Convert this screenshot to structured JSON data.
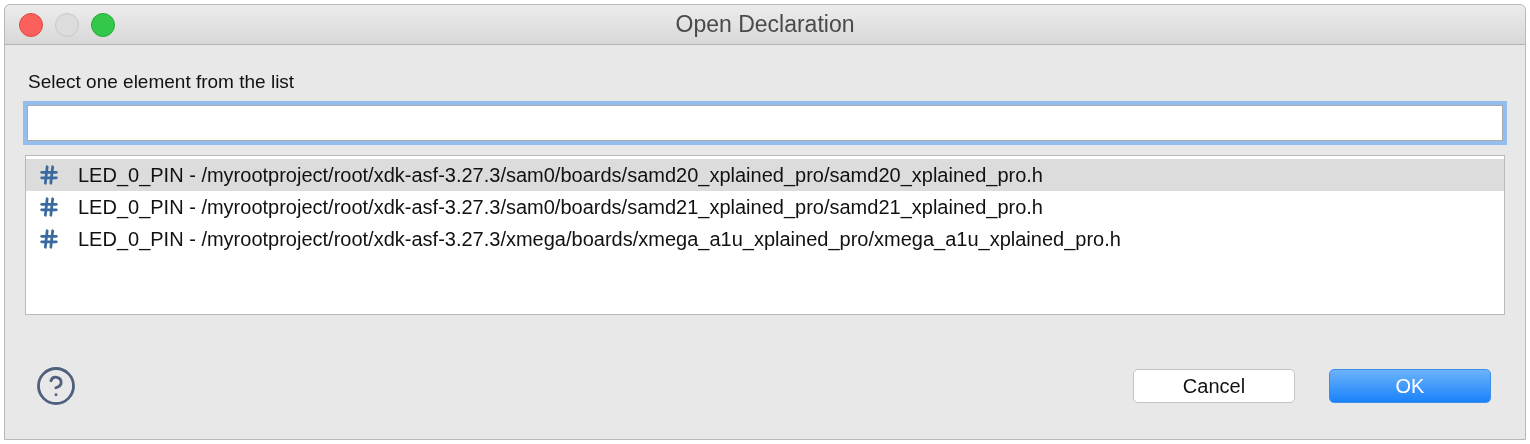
{
  "window": {
    "title": "Open Declaration"
  },
  "prompt": "Select one element from the list",
  "filter": {
    "focused": true
  },
  "items": [
    {
      "label": "LED_0_PIN - /myrootproject/root/xdk-asf-3.27.3/sam0/boards/samd20_xplained_pro/samd20_xplained_pro.h",
      "selected": true
    },
    {
      "label": "LED_0_PIN - /myrootproject/root/xdk-asf-3.27.3/sam0/boards/samd21_xplained_pro/samd21_xplained_pro.h",
      "selected": false
    },
    {
      "label": "LED_0_PIN - /myrootproject/root/xdk-asf-3.27.3/xmega/boards/xmega_a1u_xplained_pro/xmega_a1u_xplained_pro.h",
      "selected": false
    }
  ],
  "buttons": [
    {
      "label": "Cancel",
      "kind": "secondary"
    },
    {
      "label": "OK",
      "kind": "primary"
    }
  ]
}
